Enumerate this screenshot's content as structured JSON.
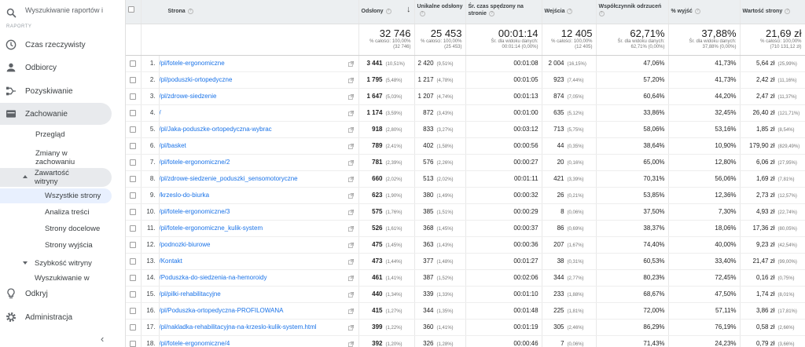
{
  "sidebar": {
    "search_placeholder": "Wyszukiwanie raportów i po",
    "cut_label": "RAPORTY",
    "items": [
      {
        "label": "Czas rzeczywisty"
      },
      {
        "label": "Odbiorcy"
      },
      {
        "label": "Pozyskiwanie"
      },
      {
        "label": "Zachowanie"
      }
    ],
    "sub": {
      "overview": "Przegląd",
      "flow_1": "Zmiany w",
      "flow_2": "zachowaniu",
      "content_1": "Zawartość",
      "content_2": "witryny",
      "all_pages": "Wszystkie strony",
      "content_drill": "Analiza treści",
      "landing": "Strony docelowe",
      "exit": "Strony wyjścia",
      "speed": "Szybkość witryny",
      "site_search": "Wyszukiwanie w"
    },
    "bottom": {
      "discover": "Odkryj",
      "admin": "Administracja"
    }
  },
  "table": {
    "headers": {
      "page": "Strona",
      "pageviews": "Odsłony",
      "unique": "Unikalne odsłony",
      "avg_time": "Śr. czas spędzony na stronie",
      "entrances": "Wejścia",
      "bounce": "Współczynnik odrzuceń",
      "exit": "% wyjść",
      "value": "Wartość strony"
    },
    "totals": {
      "pageviews": "32 746",
      "pageviews_sub1": "% całości: 100,00%",
      "pageviews_sub2": "(32 746)",
      "unique": "25 453",
      "unique_sub1": "% całości: 100,00%",
      "unique_sub2": "(25 453)",
      "avg_time": "00:01:14",
      "avg_time_sub1": "Śr. dla widoku danych:",
      "avg_time_sub2": "00:01:14 (0,00%)",
      "entrances": "12 405",
      "entrances_sub1": "% całości: 100,00%",
      "entrances_sub2": "(12 405)",
      "bounce": "62,71%",
      "bounce_sub1": "Śr. dla widoku danych:",
      "bounce_sub2": "62,71% (0,00%)",
      "exit": "37,88%",
      "exit_sub1": "Śr. dla widoku danych:",
      "exit_sub2": "37,88% (0,00%)",
      "value": "21,69 zł",
      "value_sub1": "% całości: 100,00%",
      "value_sub2": "(710 131,12 zł)"
    },
    "rows": [
      {
        "idx": "1.",
        "page": "/pl/fotele-ergonomiczne",
        "pv": "3 441",
        "pv_pct": "(10,51%)",
        "uq": "2 420",
        "uq_pct": "(9,51%)",
        "time": "00:01:08",
        "ent": "2 004",
        "ent_pct": "(16,15%)",
        "bounce": "47,06%",
        "exit": "41,73%",
        "val": "5,64 zł",
        "val_pct": "(25,99%)"
      },
      {
        "idx": "2.",
        "page": "/pl/poduszki-ortopedyczne",
        "pv": "1 795",
        "pv_pct": "(5,48%)",
        "uq": "1 217",
        "uq_pct": "(4,78%)",
        "time": "00:01:05",
        "ent": "923",
        "ent_pct": "(7,44%)",
        "bounce": "57,20%",
        "exit": "41,73%",
        "val": "2,42 zł",
        "val_pct": "(11,16%)"
      },
      {
        "idx": "3.",
        "page": "/pl/zdrowe-siedzenie",
        "pv": "1 647",
        "pv_pct": "(5,03%)",
        "uq": "1 207",
        "uq_pct": "(4,74%)",
        "time": "00:01:13",
        "ent": "874",
        "ent_pct": "(7,05%)",
        "bounce": "60,64%",
        "exit": "44,20%",
        "val": "2,47 zł",
        "val_pct": "(11,37%)"
      },
      {
        "idx": "4.",
        "page": "/",
        "pv": "1 174",
        "pv_pct": "(3,59%)",
        "uq": "872",
        "uq_pct": "(3,43%)",
        "time": "00:01:00",
        "ent": "635",
        "ent_pct": "(5,12%)",
        "bounce": "33,86%",
        "exit": "32,45%",
        "val": "26,40 zł",
        "val_pct": "(121,71%)"
      },
      {
        "idx": "5.",
        "page": "/pl/Jaka-poduszke-ortopedyczna-wybrac",
        "pv": "918",
        "pv_pct": "(2,80%)",
        "uq": "833",
        "uq_pct": "(3,27%)",
        "time": "00:03:12",
        "ent": "713",
        "ent_pct": "(5,75%)",
        "bounce": "58,06%",
        "exit": "53,16%",
        "val": "1,85 zł",
        "val_pct": "(8,54%)"
      },
      {
        "idx": "6.",
        "page": "/pl/basket",
        "pv": "789",
        "pv_pct": "(2,41%)",
        "uq": "402",
        "uq_pct": "(1,58%)",
        "time": "00:00:56",
        "ent": "44",
        "ent_pct": "(0,35%)",
        "bounce": "38,64%",
        "exit": "10,90%",
        "val": "179,90 zł",
        "val_pct": "(829,49%)"
      },
      {
        "idx": "7.",
        "page": "/pl/fotele-ergonomiczne/2",
        "pv": "781",
        "pv_pct": "(2,39%)",
        "uq": "576",
        "uq_pct": "(2,26%)",
        "time": "00:00:27",
        "ent": "20",
        "ent_pct": "(0,16%)",
        "bounce": "65,00%",
        "exit": "12,80%",
        "val": "6,06 zł",
        "val_pct": "(27,95%)"
      },
      {
        "idx": "8.",
        "page": "/pl/zdrowe-siedzenie_poduszki_sensomotoryczne",
        "pv": "660",
        "pv_pct": "(2,02%)",
        "uq": "513",
        "uq_pct": "(2,02%)",
        "time": "00:01:11",
        "ent": "421",
        "ent_pct": "(3,39%)",
        "bounce": "70,31%",
        "exit": "56,06%",
        "val": "1,69 zł",
        "val_pct": "(7,81%)"
      },
      {
        "idx": "9.",
        "page": "/krzeslo-do-biurka",
        "pv": "623",
        "pv_pct": "(1,90%)",
        "uq": "380",
        "uq_pct": "(1,49%)",
        "time": "00:00:32",
        "ent": "26",
        "ent_pct": "(0,21%)",
        "bounce": "53,85%",
        "exit": "12,36%",
        "val": "2,73 zł",
        "val_pct": "(12,57%)"
      },
      {
        "idx": "10.",
        "page": "/pl/fotele-ergonomiczne/3",
        "pv": "575",
        "pv_pct": "(1,76%)",
        "uq": "385",
        "uq_pct": "(1,51%)",
        "time": "00:00:29",
        "ent": "8",
        "ent_pct": "(0,06%)",
        "bounce": "37,50%",
        "exit": "7,30%",
        "val": "4,93 zł",
        "val_pct": "(22,74%)"
      },
      {
        "idx": "11.",
        "page": "/pl/fotele-ergonomiczne_kulik-system",
        "pv": "526",
        "pv_pct": "(1,61%)",
        "uq": "368",
        "uq_pct": "(1,45%)",
        "time": "00:00:37",
        "ent": "86",
        "ent_pct": "(0,69%)",
        "bounce": "38,37%",
        "exit": "18,06%",
        "val": "17,36 zł",
        "val_pct": "(80,05%)"
      },
      {
        "idx": "12.",
        "page": "/podnozki-biurowe",
        "pv": "475",
        "pv_pct": "(1,45%)",
        "uq": "363",
        "uq_pct": "(1,43%)",
        "time": "00:00:36",
        "ent": "207",
        "ent_pct": "(1,67%)",
        "bounce": "74,40%",
        "exit": "40,00%",
        "val": "9,23 zł",
        "val_pct": "(42,54%)"
      },
      {
        "idx": "13.",
        "page": "/Kontakt",
        "pv": "473",
        "pv_pct": "(1,44%)",
        "uq": "377",
        "uq_pct": "(1,48%)",
        "time": "00:01:27",
        "ent": "38",
        "ent_pct": "(0,31%)",
        "bounce": "60,53%",
        "exit": "33,40%",
        "val": "21,47 zł",
        "val_pct": "(99,00%)"
      },
      {
        "idx": "14.",
        "page": "/Poduszka-do-siedzenia-na-hemoroidy",
        "pv": "461",
        "pv_pct": "(1,41%)",
        "uq": "387",
        "uq_pct": "(1,52%)",
        "time": "00:02:06",
        "ent": "344",
        "ent_pct": "(2,77%)",
        "bounce": "80,23%",
        "exit": "72,45%",
        "val": "0,16 zł",
        "val_pct": "(0,75%)"
      },
      {
        "idx": "15.",
        "page": "/pl/pilki-rehabilitacyjne",
        "pv": "440",
        "pv_pct": "(1,34%)",
        "uq": "339",
        "uq_pct": "(1,33%)",
        "time": "00:01:10",
        "ent": "233",
        "ent_pct": "(1,88%)",
        "bounce": "68,67%",
        "exit": "47,50%",
        "val": "1,74 zł",
        "val_pct": "(8,01%)"
      },
      {
        "idx": "16.",
        "page": "/pl/Poduszka-ortopedyczna-PROFILOWANA",
        "pv": "415",
        "pv_pct": "(1,27%)",
        "uq": "344",
        "uq_pct": "(1,35%)",
        "time": "00:01:48",
        "ent": "225",
        "ent_pct": "(1,81%)",
        "bounce": "72,00%",
        "exit": "57,11%",
        "val": "3,86 zł",
        "val_pct": "(17,81%)"
      },
      {
        "idx": "17.",
        "page": "/pl/nakladka-rehabilitacyjna-na-krzeslo-kulik-system.html",
        "pv": "399",
        "pv_pct": "(1,22%)",
        "uq": "360",
        "uq_pct": "(1,41%)",
        "time": "00:01:19",
        "ent": "305",
        "ent_pct": "(2,46%)",
        "bounce": "86,29%",
        "exit": "76,19%",
        "val": "0,58 zł",
        "val_pct": "(2,66%)"
      },
      {
        "idx": "18.",
        "page": "/pl/fotele-ergonomiczne/4",
        "pv": "392",
        "pv_pct": "(1,20%)",
        "uq": "326",
        "uq_pct": "(1,28%)",
        "time": "00:00:46",
        "ent": "7",
        "ent_pct": "(0,06%)",
        "bounce": "71,43%",
        "exit": "24,23%",
        "val": "0,79 zł",
        "val_pct": "(3,66%)"
      }
    ]
  }
}
